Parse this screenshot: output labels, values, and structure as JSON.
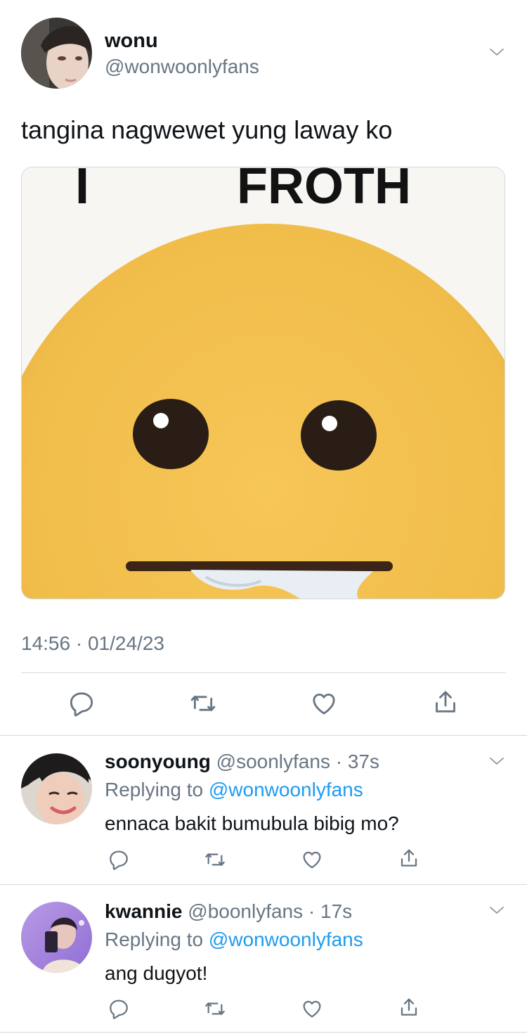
{
  "main_tweet": {
    "display_name": "wonu",
    "handle": "@wonwoonlyfans",
    "text": "tangina nagwewet yung laway ko",
    "meme_caption_left": "I",
    "meme_caption_right": "FROTH",
    "time": "14:56",
    "date": "01/24/23"
  },
  "replies": [
    {
      "display_name": "soonyoung",
      "handle": "@soonlyfans",
      "age": "37s",
      "replying_prefix": "Replying to",
      "replying_handle": "@wonwoonlyfans",
      "text": "ennaca bakit bumubula bibig mo?"
    },
    {
      "display_name": "kwannie",
      "handle": "@boonlyfans",
      "age": "17s",
      "replying_prefix": "Replying to",
      "replying_handle": "@wonwoonlyfans",
      "text": "ang dugyot!"
    }
  ],
  "colors": {
    "link": "#1d9bf0",
    "muted": "#687684",
    "divider": "#d4d9de",
    "emoji_yellow": "#f3c150"
  },
  "icons": [
    "chevron-down-icon",
    "reply-icon",
    "retweet-icon",
    "like-icon",
    "share-icon"
  ]
}
